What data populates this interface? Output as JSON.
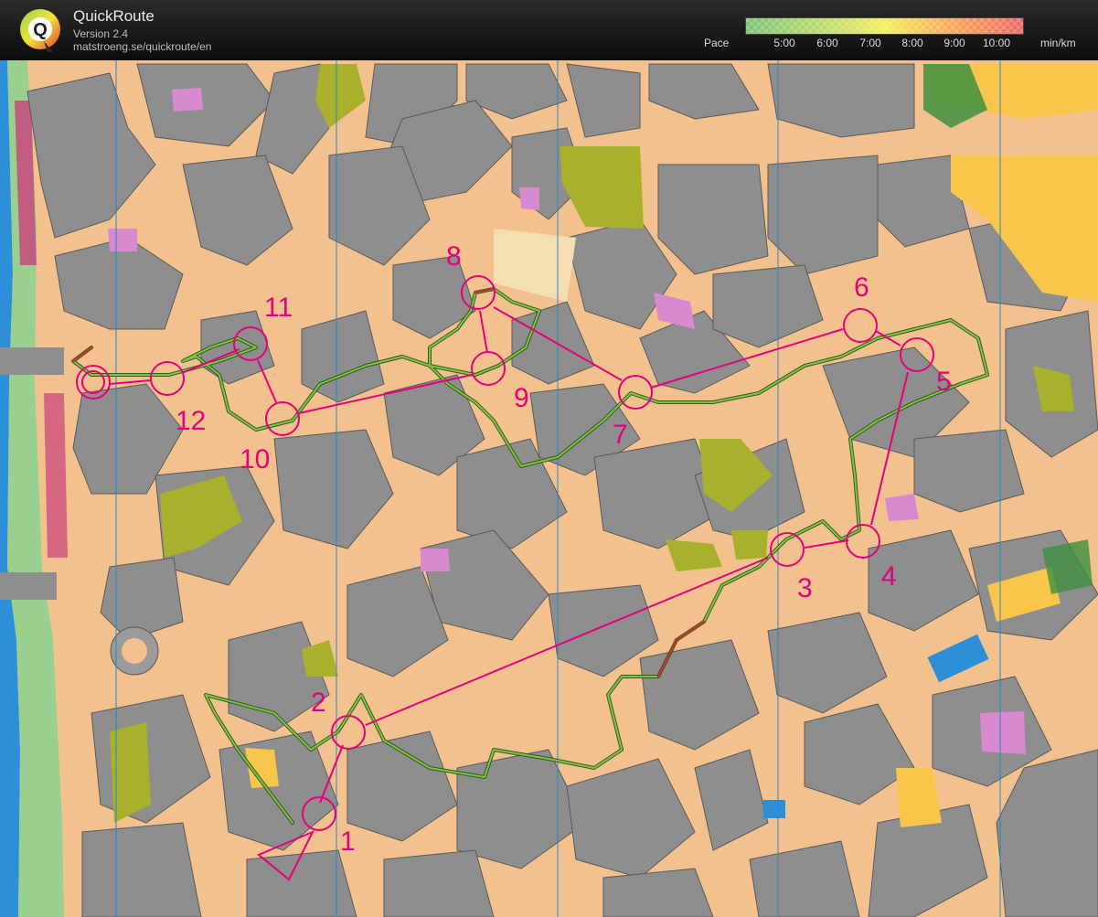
{
  "app": {
    "title": "QuickRoute",
    "version": "Version 2.4",
    "url": "matstroeng.se/quickroute/en"
  },
  "pace_legend": {
    "label": "Pace",
    "ticks": [
      "5:00",
      "6:00",
      "7:00",
      "8:00",
      "9:00",
      "10:00"
    ],
    "unit": "min/km",
    "colors": [
      "#7fc47a",
      "#c2dd6f",
      "#f3ee62",
      "#f6a85b",
      "#ee6a6a"
    ]
  },
  "map": {
    "type": "orienteering sprint map with GPS route",
    "colors": {
      "paved": "#f3c18e",
      "building": "#8e8e8e",
      "olive": "#a8b02c",
      "pink": "#d88ad0",
      "green": "#3f8f3f",
      "water": "#2c8fd8",
      "course": "#e5007d",
      "route_green": "#3a7d2a",
      "route_red": "#c0392b",
      "meridian": "#2e87c7"
    },
    "course_controls": [
      "1",
      "2",
      "3",
      "4",
      "5",
      "6",
      "7",
      "8",
      "9",
      "10",
      "11",
      "12"
    ]
  }
}
